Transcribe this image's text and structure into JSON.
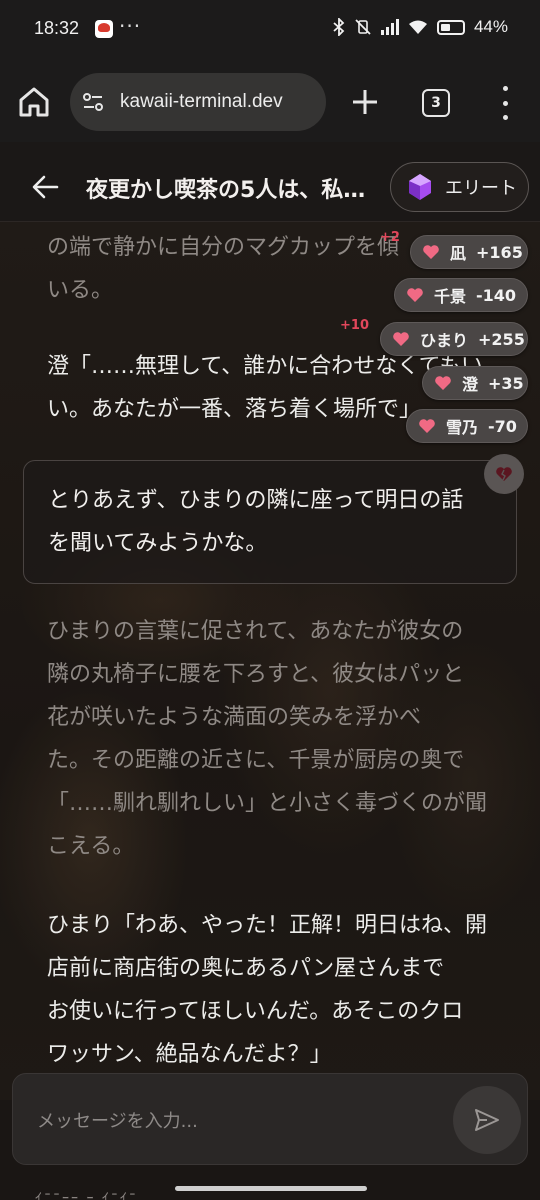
{
  "status_bar": {
    "time": "18:32",
    "overflow": "···",
    "battery": "44%"
  },
  "browser": {
    "url": "kawaii-terminal.dev",
    "tab_count": "3"
  },
  "chat": {
    "title": "夜更かし喫茶の5人は、私…",
    "badge": "エリート"
  },
  "messages": {
    "m1_line1": "の端で静かに自分のマグカップを傾",
    "m1_line2": "いる。",
    "m2_line1": "澄「……無理して、誰かに合わせなくてもい",
    "m2_line2": "い。あなたが一番、落ち着く場所で」",
    "user_line1": "とりあえず、ひまりの隣に座って明日の話",
    "user_line2": "を聞いてみようかな。",
    "m3_lines": [
      "ひまりの言葉に促されて、あなたが彼女の",
      "隣の丸椅子に腰を下ろすと、彼女はパッと",
      "花が咲いたような満面の笑みを浮かべ",
      "た。その距離の近さに、千景が厨房の奥で",
      "「……馴れ馴れしい」と小さく毒づくのが聞",
      "こえる。"
    ],
    "m4_lines": [
      "ひまり「わあ、やった！正解！明日はね、開",
      "店前に商店街の奥にあるパン屋さんまで",
      "お使いに行ってほしいんだ。あそこのクロ",
      "ワッサン、絶品なんだよ？」"
    ],
    "bottom_peek": "ｲﾆﾆｰｰ ｰ ｲﾆｲﾆ"
  },
  "affinity": [
    {
      "name": "凪",
      "value": "+165"
    },
    {
      "name": "千景",
      "value": "-140"
    },
    {
      "name": "ひまり",
      "value": "+255"
    },
    {
      "name": "澄",
      "value": "+35"
    },
    {
      "name": "雪乃",
      "value": "-70"
    }
  ],
  "affinity_deltas": {
    "first": "+2",
    "second": "+10"
  },
  "input": {
    "placeholder": "メッセージを入力..."
  },
  "colors": {
    "heart": "#f06a84",
    "gem": "#a64cf0",
    "delta": "#e2475b"
  }
}
